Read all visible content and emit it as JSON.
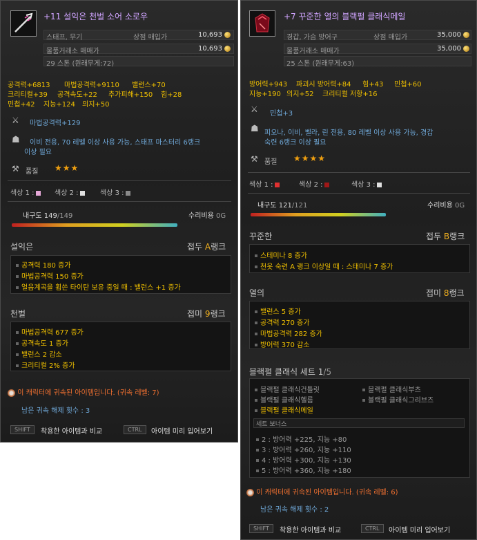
{
  "left": {
    "title": "+11 설익은 천벌 소어 소로우",
    "type": "스태프, 무기",
    "shop_label": "상점 매입가",
    "shop_price": "10,693",
    "trade_label": "물품거래소 매매가",
    "trade_price": "10,693",
    "weight": "29 스톤 (원래무게:72)",
    "stats": [
      "공격력+6813",
      "마법공격력+9110",
      "밸런스+70",
      "크리티컬+39",
      "공격속도+22",
      "추가피해+150",
      "힘+28",
      "민첩+42",
      "지능+124",
      "의지+50"
    ],
    "magic_atk": "마법공격력+129",
    "req": [
      "이비 전용, 70 레벨 이상 사용 가능, 스태프 마스터리 6랭크",
      "이상 필요"
    ],
    "quality_label": "품질",
    "stars": "★★★",
    "colors": [
      "색상 1 :",
      "색상 2 :",
      "색상 3 :"
    ],
    "color_vals": [
      "#e6a8d8",
      "#e0e0e0",
      "#8a8a8a"
    ],
    "durability_label": "내구도",
    "durability_cur": "149",
    "durability_max": "/149",
    "repair_label": "수리비용",
    "repair_val": "0G",
    "ench1_name": "설익은",
    "ench1_type": "접두",
    "ench1_rank": "A",
    "rank_suffix": "랭크",
    "ench1_effects": [
      "공격력 180 증가",
      "마법공격력 150 증가",
      "얼음계곡을 휩쓴 타이탄 보유 중일 때 : 밸런스 +1 증가"
    ],
    "ench2_name": "천벌",
    "ench2_type": "접미",
    "ench2_rank": "9",
    "ench2_effects": [
      "마법공격력 677 증가",
      "공격속도 1 증가",
      "밸런스 2 감소",
      "크리티컬 2% 증가"
    ],
    "bound": "이 캐릭터에 귀속된 아이템입니다. (귀속 레벨: 7)",
    "unbind": "남은 귀속 해제 횟수 : 3",
    "shift": "SHIFT",
    "compare": "착용한 아이템과 비교",
    "ctrl": "CTRL",
    "preview": "아이템 미리 입어보기"
  },
  "right": {
    "title": "+7 꾸준한 열의 블랙펄 클래식메일",
    "type": "경갑, 가슴 방어구",
    "shop_label": "상점 매입가",
    "shop_price": "35,000",
    "trade_label": "물품거래소 매매가",
    "trade_price": "35,000",
    "weight": "25 스톤 (원래무게:63)",
    "stats": [
      "방어력+943",
      "파괴시 방어력+84",
      "힘+43",
      "민첩+60",
      "지능+190",
      "의지+52",
      "크리티컬 저항+16"
    ],
    "dex": "민첩+3",
    "req": [
      "피오나, 이비, 벨라, 린 전용, 80 레벨 이상 사용 가능, 경갑",
      "숙련 6랭크 이상 필요"
    ],
    "quality_label": "품질",
    "stars": "★★★★",
    "colors": [
      "색상 1 :",
      "색상 2 :",
      "색상 3 :"
    ],
    "color_vals": [
      "#e03030",
      "#a01818",
      "#e0e0e0"
    ],
    "durability_label": "내구도",
    "durability_cur": "121",
    "durability_max": "/121",
    "repair_label": "수리비용",
    "repair_val": "0G",
    "ench1_name": "꾸준한",
    "ench1_type": "접두",
    "ench1_rank": "B",
    "rank_suffix": "랭크",
    "ench1_effects": [
      "스테미나 8 증가",
      "천옷 숙련 A 랭크 이상일 때 : 스태미나 7 증가"
    ],
    "ench2_name": "열의",
    "ench2_type": "접미",
    "ench2_rank": "8",
    "ench2_effects": [
      "밸런스 5 증가",
      "공격력 270 증가",
      "마법공격력 282 증가",
      "방어력 370 감소"
    ],
    "set_title": "블랙펄 클래식 세트",
    "set_count": "1",
    "set_total": "/5",
    "set_items": [
      "블랙펄 클래식건틀릿",
      "블랙펄 클래식부츠",
      "블랙펄 클래식헬름",
      "블랙펄 클래식그리브즈",
      "블랙펄 클래식메일"
    ],
    "set_bonus_label": "세트 보너스",
    "set_bonuses": [
      "2 : 방어력 +225, 지능 +80",
      "3 : 방어력 +260, 지능 +110",
      "4 : 방어력 +300, 지능 +130",
      "5 : 방어력 +360, 지능 +180"
    ],
    "bound": "이 캐릭터에 귀속된 아이템입니다. (귀속 레벨: 6)",
    "unbind": "남은 귀속 해제 횟수 : 2",
    "shift": "SHIFT",
    "compare": "착용한 아이템과 비교",
    "ctrl": "CTRL",
    "preview": "아이템 미리 입어보기"
  },
  "colors": {
    "title": "#d0a4ff",
    "stat": "#f0c000",
    "rank": "#f0b020",
    "bound": "#f07030"
  }
}
